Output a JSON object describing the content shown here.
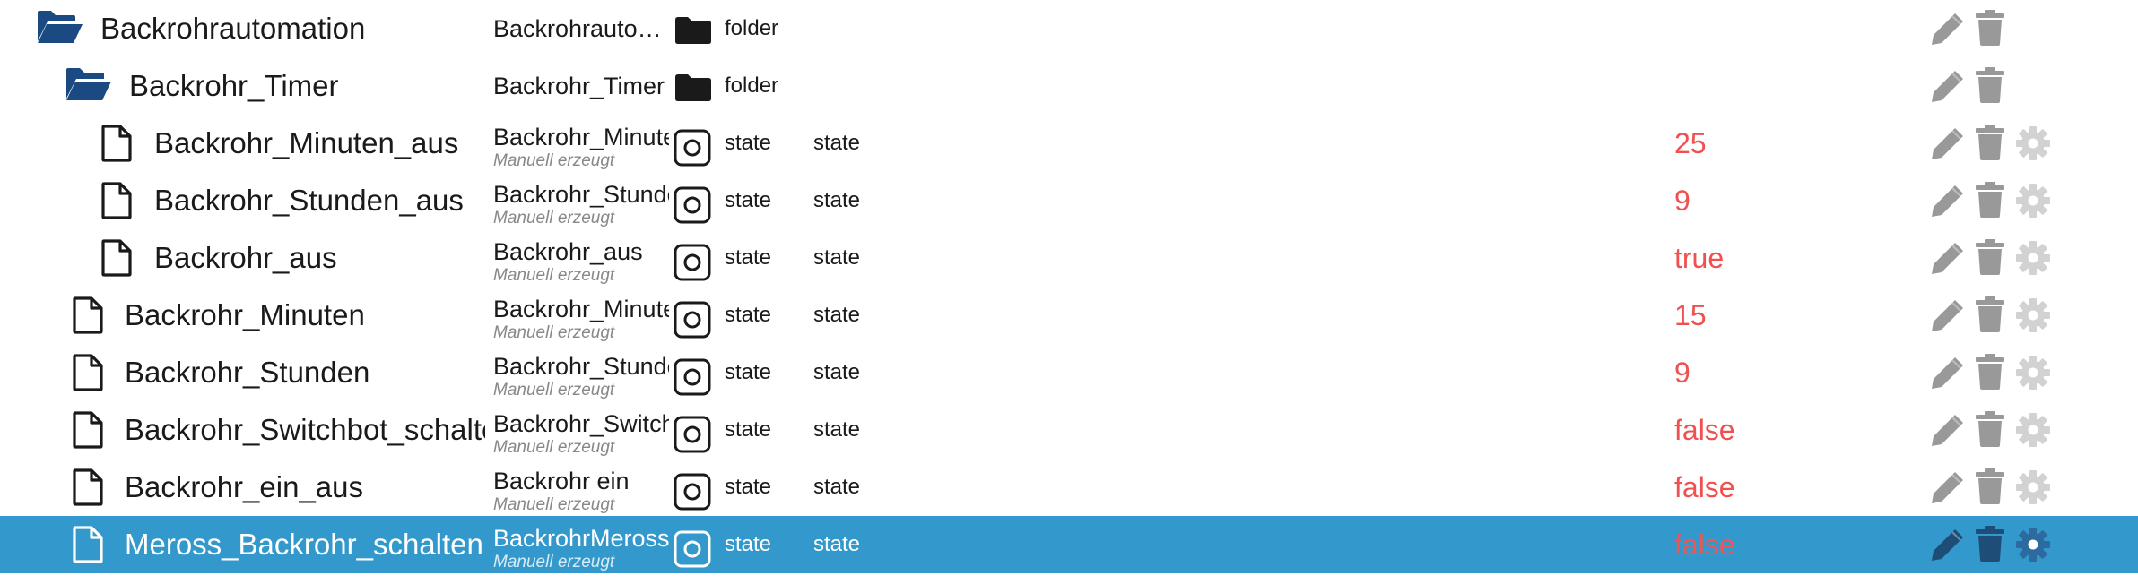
{
  "colors": {
    "selection_bg": "#3399cc",
    "folder_icon": "#1b4a82",
    "value_text": "#f05050",
    "action_icon": "#999999",
    "action_icon_selected": "#1e4d78"
  },
  "rows": [
    {
      "name": "Backrohrautomation",
      "display_name": "Backrohrauto…",
      "subtitle": "",
      "type_icon": "folder-icon",
      "type_label": "folder",
      "role": "",
      "value": "",
      "icon": "folder-open-icon",
      "selected": false,
      "settings": false
    },
    {
      "name": "Backrohr_Timer",
      "display_name": "Backrohr_Timer",
      "subtitle": "",
      "type_icon": "folder-icon",
      "type_label": "folder",
      "role": "",
      "value": "",
      "icon": "folder-open-icon",
      "selected": false,
      "settings": false
    },
    {
      "name": "Backrohr_Minuten_aus",
      "display_name": "Backrohr_Minute",
      "subtitle": "Manuell erzeugt",
      "type_icon": "state-icon",
      "type_label": "state",
      "role": "state",
      "value": "25",
      "icon": "file-icon",
      "selected": false,
      "settings": true
    },
    {
      "name": "Backrohr_Stunden_aus",
      "display_name": "Backrohr_Stunde",
      "subtitle": "Manuell erzeugt",
      "type_icon": "state-icon",
      "type_label": "state",
      "role": "state",
      "value": "9",
      "icon": "file-icon",
      "selected": false,
      "settings": true
    },
    {
      "name": "Backrohr_aus",
      "display_name": "Backrohr_aus",
      "subtitle": "Manuell erzeugt",
      "type_icon": "state-icon",
      "type_label": "state",
      "role": "state",
      "value": "true",
      "icon": "file-icon",
      "selected": false,
      "settings": true
    },
    {
      "name": "Backrohr_Minuten",
      "display_name": "Backrohr_Minute",
      "subtitle": "Manuell erzeugt",
      "type_icon": "state-icon",
      "type_label": "state",
      "role": "state",
      "value": "15",
      "icon": "file-icon",
      "selected": false,
      "settings": true
    },
    {
      "name": "Backrohr_Stunden",
      "display_name": "Backrohr_Stunde",
      "subtitle": "Manuell erzeugt",
      "type_icon": "state-icon",
      "type_label": "state",
      "role": "state",
      "value": "9",
      "icon": "file-icon",
      "selected": false,
      "settings": true
    },
    {
      "name": "Backrohr_Switchbot_schalten",
      "display_name": "Backrohr_Switch",
      "subtitle": "Manuell erzeugt",
      "type_icon": "state-icon",
      "type_label": "state",
      "role": "state",
      "value": "false",
      "icon": "file-icon",
      "selected": false,
      "settings": true
    },
    {
      "name": "Backrohr_ein_aus",
      "display_name": "Backrohr ein",
      "subtitle": "Manuell erzeugt",
      "type_icon": "state-icon",
      "type_label": "state",
      "role": "state",
      "value": "false",
      "icon": "file-icon",
      "selected": false,
      "settings": true
    },
    {
      "name": "Meross_Backrohr_schalten",
      "display_name": "BackrohrMeross",
      "subtitle": "Manuell erzeugt",
      "type_icon": "state-icon",
      "type_label": "state",
      "role": "state",
      "value": "false",
      "icon": "file-icon",
      "selected": true,
      "settings": true
    }
  ]
}
